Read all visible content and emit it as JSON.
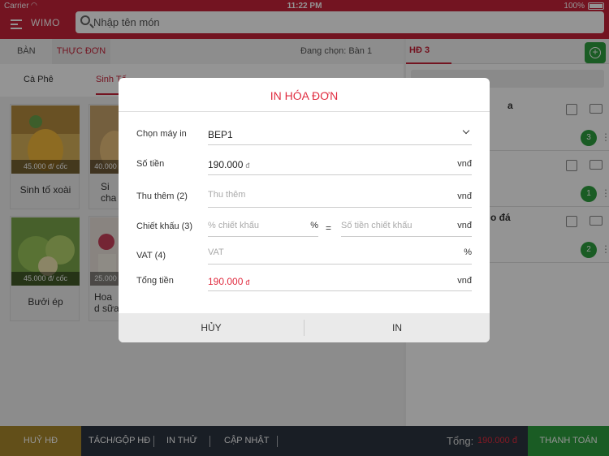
{
  "status_bar": {
    "carrier": "Carrier",
    "time": "11:22 PM",
    "battery": "100%"
  },
  "header": {
    "brand": "WIMO",
    "search_placeholder": "Nhập tên món"
  },
  "tabs": {
    "ban": "BÀN",
    "thuc_don": "THỰC ĐƠN",
    "dang_chon": "Đang chọn: Bàn 1"
  },
  "categories": [
    {
      "label": "Cà Phê"
    },
    {
      "label": "Sinh Tố"
    }
  ],
  "products": [
    {
      "price": "45.000 đ/ cốc",
      "name": "Sinh tố xoài"
    },
    {
      "price": "40.000",
      "name": "Si cha"
    },
    {
      "price": "45.000 đ/ cốc",
      "name": "Bưởi ép"
    },
    {
      "price": "25.000",
      "name": "Hoa d sữa"
    }
  ],
  "order_panel": {
    "tab_label": "HĐ 3",
    "items": [
      {
        "name_partial": "a",
        "qty": "3"
      },
      {
        "name_partial": "",
        "qty": "1"
      },
      {
        "name_partial": "o đá",
        "qty": "2"
      }
    ]
  },
  "bottom_bar": {
    "huy_hd": "HUỶ HĐ",
    "tach_gop": "TÁCH/GỘP HĐ",
    "in_thu": "IN THỬ",
    "cap_nhat": "CẬP NHẬT",
    "tong_label": "Tổng:",
    "tong_value": "190.000 đ",
    "thanh_toan": "THANH TOÁN"
  },
  "dialog": {
    "title": "IN HÓA ĐƠN",
    "printer_label": "Chọn máy in",
    "printer_value": "BEP1",
    "so_tien_label": "Số tiền",
    "so_tien_value": "190.000",
    "currency_symbol": "đ",
    "unit_vnd": "vnđ",
    "thu_them_label": "Thu thêm (2)",
    "thu_them_placeholder": "Thu thêm",
    "chiet_khau_label": "Chiết khấu (3)",
    "chiet_khau_percent_placeholder": "% chiết khấu",
    "percent_sign": "%",
    "equals_sign": "=",
    "chiet_khau_amount_placeholder": "Số tiền chiết khấu",
    "vat_label": "VAT (4)",
    "vat_placeholder": "VAT",
    "tong_tien_label": "Tổng tiền",
    "tong_tien_value": "190.000",
    "cancel_label": "HỦY",
    "print_label": "IN"
  },
  "colors": {
    "brand": "#c7243a",
    "accent_green": "#2e9f3e",
    "gold": "#a9892c",
    "dark": "#2b3440"
  }
}
